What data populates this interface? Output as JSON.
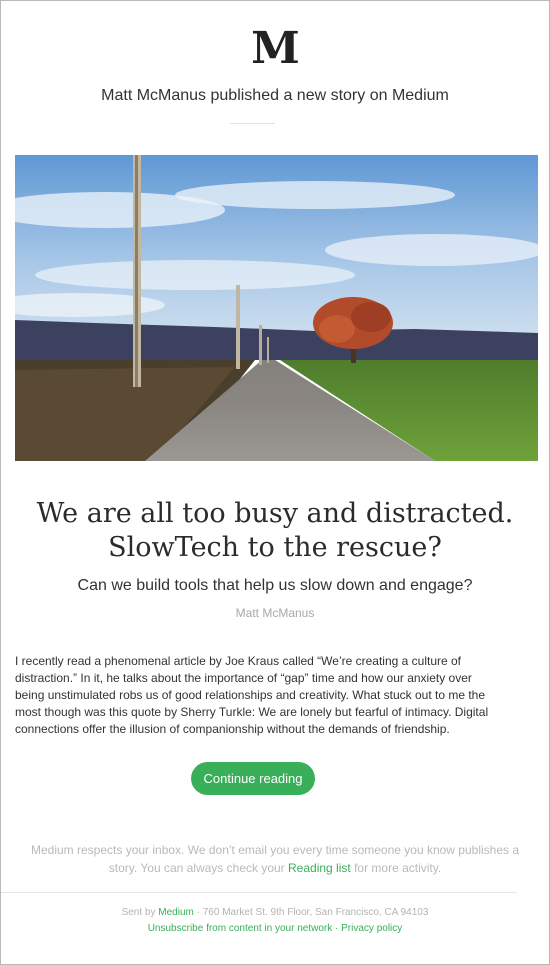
{
  "header": {
    "logo_text": "M",
    "notice": "Matt McManus published a new story on Medium"
  },
  "hero": {
    "image_icon": "hero-photo-road-landscape"
  },
  "story": {
    "title_line1": "We are all too busy and distracted.",
    "title_line2": "SlowTech to the rescue?",
    "subtitle": "Can we build tools that help us slow down and engage?",
    "author": "Matt McManus",
    "excerpt": "I recently read a phenomenal article by Joe Kraus called “We’re creating a culture of distraction.” In it, he talks about the importance of “gap” time and how our anxiety over being unstimulated robs us of good relationships and creativity. What stuck out to me the most though was this quote by Sherry Turkle: We are lonely but fearful of intimacy. Digital connections offer the illusion of companionship without the demands of friendship.",
    "cta_label": "Continue reading"
  },
  "inbox_note": {
    "part1": "Medium respects your inbox. We don’t email you every time someone you know publishes a story. You can always check your",
    "link_label": "Reading list",
    "part2": "for more activity."
  },
  "footer": {
    "sent_by_prefix": "Sent by",
    "brand_link": "Medium",
    "address": "· 760 Market St. 9th Floor, San Francisco, CA 94103",
    "unsubscribe_label": "Unsubscribe from content in your network",
    "separator": "·",
    "privacy_label": "Privacy policy"
  },
  "colors": {
    "accent_green": "#3aaf5a",
    "text_dark": "#333333",
    "text_muted": "#b9b9b9"
  }
}
